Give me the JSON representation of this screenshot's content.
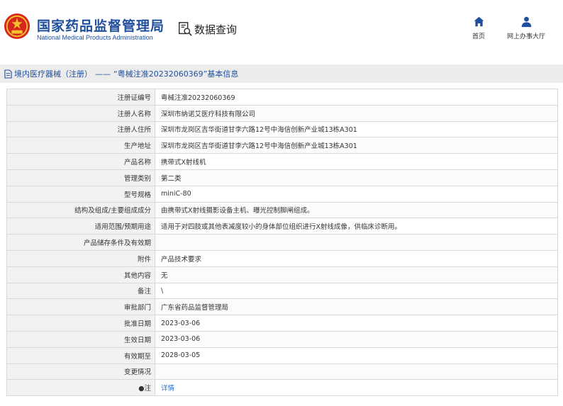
{
  "header": {
    "agency_cn": "国家药品监督管理局",
    "agency_en": "National Medical Products Administration",
    "search_title": "数据查询",
    "nav": [
      {
        "label": "首页",
        "icon": "home-icon"
      },
      {
        "label": "网上办事大厅",
        "icon": "user-icon"
      }
    ]
  },
  "breadcrumb": {
    "category": "境内医疗器械（注册）",
    "separator": "——",
    "record": "“粤械注准20232060369”基本信息"
  },
  "table": {
    "rows": [
      {
        "label": "注册证编号",
        "value": "粤械注准20232060369"
      },
      {
        "label": "注册人名称",
        "value": "深圳市纳诺艾医疗科技有限公司"
      },
      {
        "label": "注册人住所",
        "value": "深圳市龙岗区吉华街道甘李六路12号中海信创新产业城13栋A301"
      },
      {
        "label": "生产地址",
        "value": "深圳市龙岗区吉华街道甘李六路12号中海信创新产业城13栋A301"
      },
      {
        "label": "产品名称",
        "value": "携带式X射线机"
      },
      {
        "label": "管理类别",
        "value": "第二类"
      },
      {
        "label": "型号规格",
        "value": "miniC-80"
      },
      {
        "label": "结构及组成/主要组成成分",
        "value": "由携带式X射线摄影设备主机、曝光控制脚闸组成。"
      },
      {
        "label": "适用范围/预期用途",
        "value": "适用于对四肢或其他表减度较小的身体部位组织进行X射线成像，供临床诊断用。"
      },
      {
        "label": "产品储存条件及有效期",
        "value": ""
      },
      {
        "label": "附件",
        "value": "产品技术要求"
      },
      {
        "label": "其他内容",
        "value": "无"
      },
      {
        "label": "备注",
        "value": "\\"
      },
      {
        "label": "审批部门",
        "value": "广东省药品监督管理局"
      },
      {
        "label": "批准日期",
        "value": "2023-03-06"
      },
      {
        "label": "生效日期",
        "value": "2023-03-06"
      },
      {
        "label": "有效期至",
        "value": "2028-03-05"
      },
      {
        "label": "变更情况",
        "value": ""
      }
    ],
    "note": {
      "label": "●注",
      "link": "详情"
    }
  },
  "colors": {
    "brand_blue": "#1f4e9c",
    "emblem_red": "#d7261e",
    "emblem_gold": "#f2c12e",
    "link_blue": "#2a6fc9",
    "label_bg": "#f2f2f2",
    "breadcrumb_bg": "#ececec"
  }
}
